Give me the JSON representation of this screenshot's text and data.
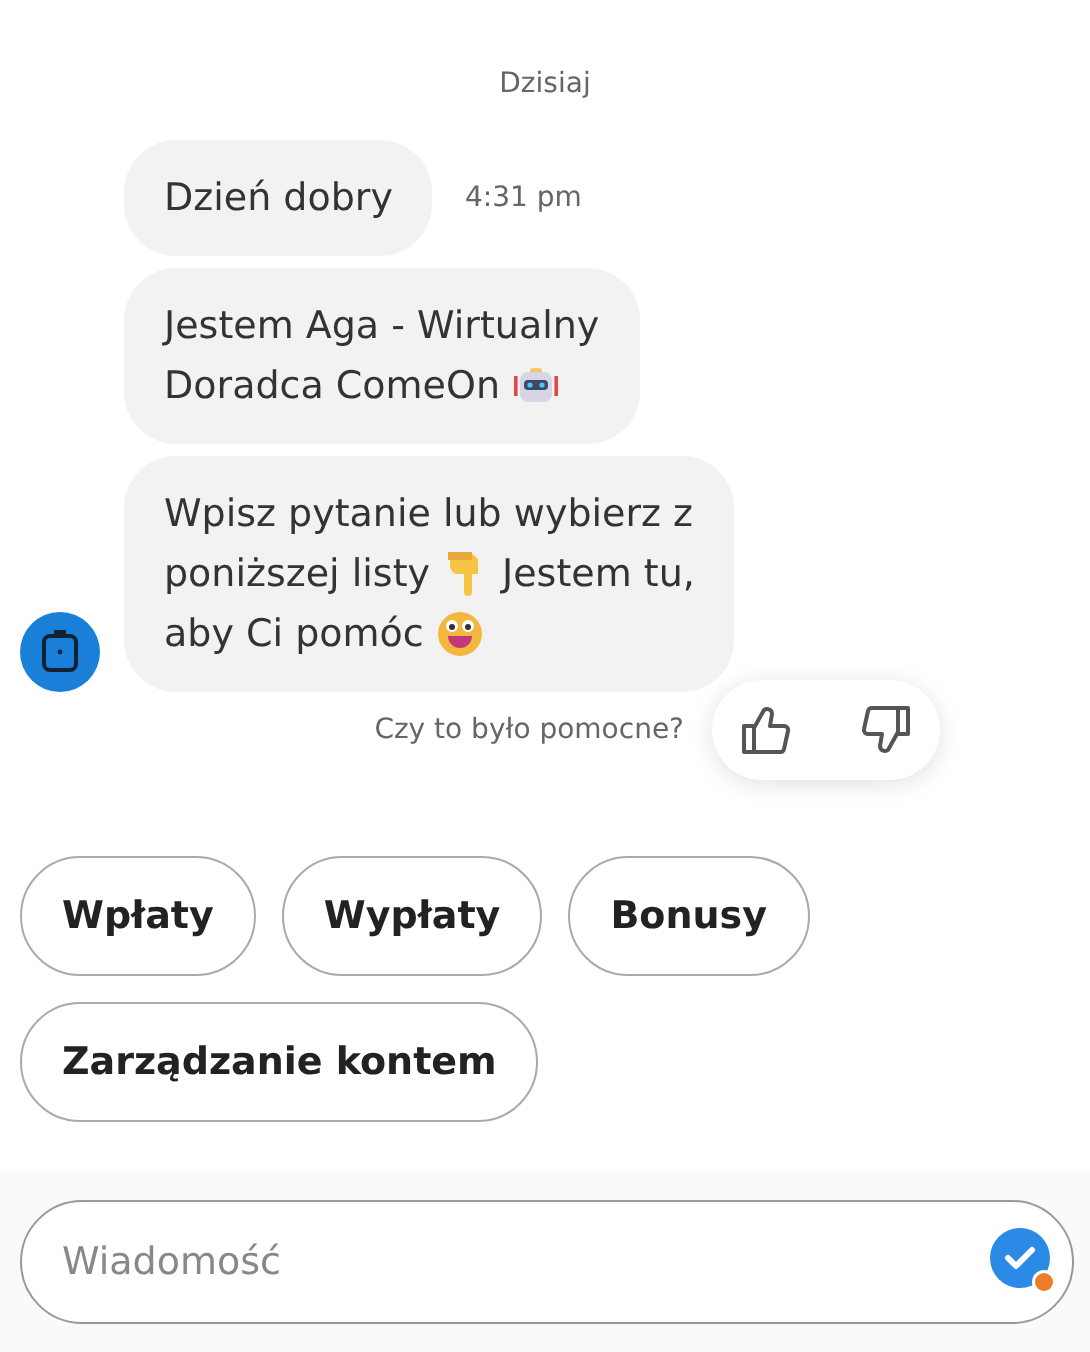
{
  "date_label": "Dzisiaj",
  "messages": [
    {
      "lines": [
        [
          {
            "kind": "text",
            "text": "Dzień dobry"
          }
        ]
      ],
      "time": "4:31 pm"
    },
    {
      "lines": [
        [
          {
            "kind": "text",
            "text": "Jestem Aga - Wirtualny"
          }
        ],
        [
          {
            "kind": "text",
            "text": "Doradca ComeOn"
          },
          {
            "kind": "robot"
          }
        ]
      ]
    },
    {
      "lines": [
        [
          {
            "kind": "text",
            "text": "Wpisz pytanie lub wybierz z"
          }
        ],
        [
          {
            "kind": "text",
            "text": "poniższej listy"
          },
          {
            "kind": "hand"
          },
          {
            "kind": "text",
            "text": "Jestem tu,"
          }
        ],
        [
          {
            "kind": "text",
            "text": "aby Ci pomóc"
          },
          {
            "kind": "smile"
          }
        ]
      ]
    }
  ],
  "feedback": {
    "question": "Czy to było pomocne?"
  },
  "quick_replies": [
    "Wpłaty",
    "Wypłaty",
    "Bonusy",
    "Zarządzanie kontem"
  ],
  "composer": {
    "placeholder": "Wiadomość"
  }
}
